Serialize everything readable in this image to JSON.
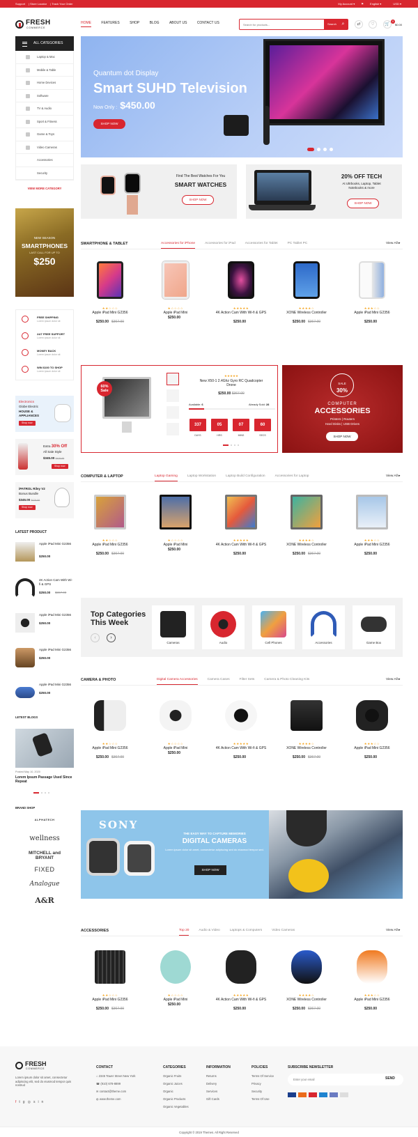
{
  "topbar": {
    "support": "Support",
    "store_locator": "Store Locator",
    "track": "Track Your Order",
    "account": "My Account",
    "language": "English",
    "currency": "USD"
  },
  "logo": {
    "name": "FRESH",
    "sub": "COMMERCE"
  },
  "nav": [
    "HOME",
    "FEATURES",
    "SHOP",
    "BLOG",
    "ABOUT US",
    "CONTACT US"
  ],
  "search": {
    "placeholder": "Search for products...",
    "button": "Search"
  },
  "cart": {
    "count": "0",
    "total": "$0.00"
  },
  "sidebar": {
    "all_categories": "ALL CATEGORIES",
    "categories": [
      "Laptop & Mac",
      "Mobile & Table",
      "Home Devices",
      "Software",
      "TV & Audio",
      "Sport & Fitness",
      "Game & Toys",
      "Video Cameras",
      "Accessories",
      "Security"
    ],
    "view_more": "VIEW MORE CATEGORY",
    "promo": {
      "line1": "NEW SEASON",
      "line2": "SMARTPHONES",
      "line3": "LAST CALL FOR UP TO",
      "price": "$250"
    },
    "services": [
      {
        "title": "FREE SHIPPING",
        "sub": "Lorem ipsum dolor sit"
      },
      {
        "title": "24/7 FREE SUPPORT",
        "sub": "Lorem ipsum dolor sit"
      },
      {
        "title": "MONEY BACK",
        "sub": "Lorem ipsum dolor sit"
      },
      {
        "title": "WIN $100 TO SHOP",
        "sub": "Lorem ipsum dolor sit"
      }
    ],
    "ban1": {
      "brand": "Electronics",
      "l1": "Globe Electric",
      "l2": "HOUSE &",
      "l3": "APPLIANCES",
      "btn": "Shop now"
    },
    "ban2": {
      "l1": "Extra",
      "pct": "30% Off",
      "l2": "All Sale Style",
      "price": "$345.00",
      "old": "$429.99",
      "btn": "Shop now"
    },
    "ban3": {
      "l1": "iPATROL",
      "l2": "Riley V2",
      "l3": "Bonus Bundle",
      "price": "$345.00",
      "old": "$429.99",
      "btn": "Shop now"
    },
    "latest_title": "LATEST PRODUCT",
    "latest": [
      {
        "name": "Apple iPad Mini G2356",
        "price": "$250.00",
        "old": ""
      },
      {
        "name": "4K Action Cam With Wi-fi & GPS",
        "price": "$250.00",
        "old": "$367.00"
      },
      {
        "name": "Apple iPad Mini G2356",
        "price": "$250.00",
        "old": ""
      },
      {
        "name": "Apple iPad Mini G2356",
        "price": "$250.00",
        "old": ""
      },
      {
        "name": "Apple iPad Mini G2356",
        "price": "$250.00",
        "old": ""
      }
    ],
    "blogs_title": "LETEST BLOGS",
    "blog": {
      "date": "Posted May 10, 2020",
      "title": "Lorem Ipsum Passage Used Since Repeat"
    },
    "brand_title": "BRAND SHOP",
    "brands": [
      "ALPHATECH",
      "wellness",
      "MITCHELL and BRYANT",
      "FIXED",
      "Analogue",
      "A&R"
    ]
  },
  "hero": {
    "line1": "Quantum dot Display",
    "line2": "Smart SUHD Television",
    "price_label": "Now Only :",
    "price": "$450.00",
    "button": "SHOP NOW"
  },
  "banner_watch": {
    "l1": "Find The Best Watches For You",
    "l2": "SMART WATCHES",
    "btn": "SHOP NOW"
  },
  "banner_tech": {
    "l1": "20% OFF TECH",
    "l2": "At Ultrbooks, Laptop, Tablet",
    "l3": "Notebooks & more",
    "btn": "SHOP NOW"
  },
  "section1": {
    "title": "SMARTPHONE & TABLET",
    "tabs": [
      "Accessories for iPhone",
      "Accessories for iPad",
      "Accessories for Tablet",
      "PC Tablet PC"
    ],
    "view_all": "View All"
  },
  "products1": [
    {
      "stars": "★★☆☆☆",
      "name": "Apple iPad Mini G2356",
      "price": "$250.00",
      "old": "$367.00"
    },
    {
      "stars": "★☆☆☆☆",
      "name": "Apple iPad Mini",
      "price": "$250.00",
      "old": ""
    },
    {
      "stars": "★★★★★",
      "name": "4K Action Cam With Wi-fi & GPS",
      "price": "$250.00",
      "old": ""
    },
    {
      "stars": "★★★★☆",
      "name": "XONE Wireless Controller",
      "price": "$250.00",
      "old": "$367.00"
    },
    {
      "stars": "★★★☆☆",
      "name": "Apple iPad Mini G2356",
      "price": "$250.00",
      "old": ""
    }
  ],
  "deal": {
    "badge1": "60%",
    "badge2": "Sale",
    "stars": "★★★★★",
    "name": "New X50-1 2.4Ghz Gyro RC Quadcopter Drone",
    "price": "$250.00",
    "old": "$367.00",
    "available_label": "Available:",
    "available": "6",
    "sold_label": "Already Sold:",
    "sold": "28",
    "count": [
      "337",
      "05",
      "07",
      "60"
    ],
    "labels": [
      "DAYS",
      "HRS",
      "MINS",
      "SECS"
    ]
  },
  "acc": {
    "sale": "SALE",
    "pct": "30%",
    "l1": "COMPUTER",
    "l2": "ACCESSORIES",
    "l3": "Printers | Routers",
    "l4": "Hard Disks | USB Drives",
    "btn": "SHOP NOW"
  },
  "section2": {
    "title": "COMPUTER & LAPTOP",
    "tabs": [
      "Laptop Gaming",
      "Laptop Workstation",
      "Laptop Build Configuration",
      "Accessories for Laptop"
    ],
    "view_all": "View All"
  },
  "products2": [
    {
      "stars": "★★☆☆☆",
      "name": "Apple iPad Mini G2356",
      "price": "$250.00",
      "old": "$367.00"
    },
    {
      "stars": "★☆☆☆☆",
      "name": "Apple iPad Mini",
      "price": "$250.00",
      "old": ""
    },
    {
      "stars": "★★★★★",
      "name": "4K Action Cam With Wi-fi & GPS",
      "price": "$250.00",
      "old": ""
    },
    {
      "stars": "★★★★☆",
      "name": "XONE Wireless Controller",
      "price": "$250.00",
      "old": "$367.00"
    },
    {
      "stars": "★★★☆☆",
      "name": "Apple iPad Mini G2356",
      "price": "$250.00",
      "old": ""
    }
  ],
  "topcat": {
    "title": "Top Categories This Week",
    "items": [
      "Cameras",
      "Audio",
      "Cell Phones",
      "Accessories",
      "Game Box"
    ]
  },
  "section3": {
    "title": "CAMERA & PHOTO",
    "tabs": [
      "Digital Camera Accessories",
      "Camera Cases",
      "Filter Sets",
      "Camera & Photo Cleaning Kits"
    ],
    "view_all": "View All"
  },
  "products3": [
    {
      "stars": "★★☆☆☆",
      "name": "Apple iPad Mini G2356",
      "price": "$250.00",
      "old": "$367.00"
    },
    {
      "stars": "★☆☆☆☆",
      "name": "Apple iPad Mini",
      "price": "$250.00",
      "old": ""
    },
    {
      "stars": "★★★★★",
      "name": "4K Action Cam With Wi-fi & GPS",
      "price": "$250.00",
      "old": ""
    },
    {
      "stars": "★★★★☆",
      "name": "XONE Wireless Controller",
      "price": "$250.00",
      "old": "$367.00"
    },
    {
      "stars": "★★★☆☆",
      "name": "Apple iPad Mini G2356",
      "price": "$250.00",
      "old": ""
    }
  ],
  "sony": {
    "brand": "SONY",
    "l1": "THE EASY WAY TO CAPTURE MEMORIES",
    "l2": "DIGITAL CAMERAS",
    "l3": "Lorem ipsum dolor sit amet, consectetur adipiscing sed do eiusmod tempor sed.",
    "btn": "SHOP NOW"
  },
  "section4": {
    "title": "ACCESSORIES",
    "tabs": [
      "Top 20",
      "Audio & Video",
      "Laptops & Computers",
      "Video Cameras"
    ],
    "view_all": "View All"
  },
  "products4": [
    {
      "stars": "★★☆☆☆",
      "name": "Apple iPad Mini G2356",
      "price": "$250.00",
      "old": "$367.00"
    },
    {
      "stars": "★☆☆☆☆",
      "name": "Apple iPad Mini",
      "price": "$250.00",
      "old": ""
    },
    {
      "stars": "★★★★★",
      "name": "4K Action Cam With Wi-fi & GPS",
      "price": "$250.00",
      "old": ""
    },
    {
      "stars": "★★★★☆",
      "name": "XONE Wireless Controller",
      "price": "$250.00",
      "old": "$367.00"
    },
    {
      "stars": "★★★☆☆",
      "name": "Apple iPad Mini G2356",
      "price": "$250.00",
      "old": ""
    }
  ],
  "footer": {
    "about": "Lorem ipsum dolor sit amet, consectetur adipiscing elit, sed do eiusmod tempor quis nostrud",
    "contact_title": "CONTACT",
    "contact": [
      "2345 Tower Street New York",
      "(910) 678-8899",
      "contact@theme.com",
      "www.theme.com"
    ],
    "cat_title": "CATEGORIES",
    "cats": [
      "Organic Fruits",
      "Organic Juices",
      "Organic",
      "Organic Products",
      "Organic Vegetables"
    ],
    "info_title": "INFORMATION",
    "info": [
      "Returns",
      "Delivery",
      "Services",
      "Gift Cards"
    ],
    "pol_title": "POLICIES",
    "pol": [
      "Terms Of Service",
      "Privacy",
      "Security",
      "Terms Of Use"
    ],
    "news_title": "SUBSCRIBE NEWSLETTER",
    "news_placeholder": "Enter your email",
    "send": "SEND",
    "copyright": "Copyright © 2019 Themes. All Right Reserved"
  }
}
